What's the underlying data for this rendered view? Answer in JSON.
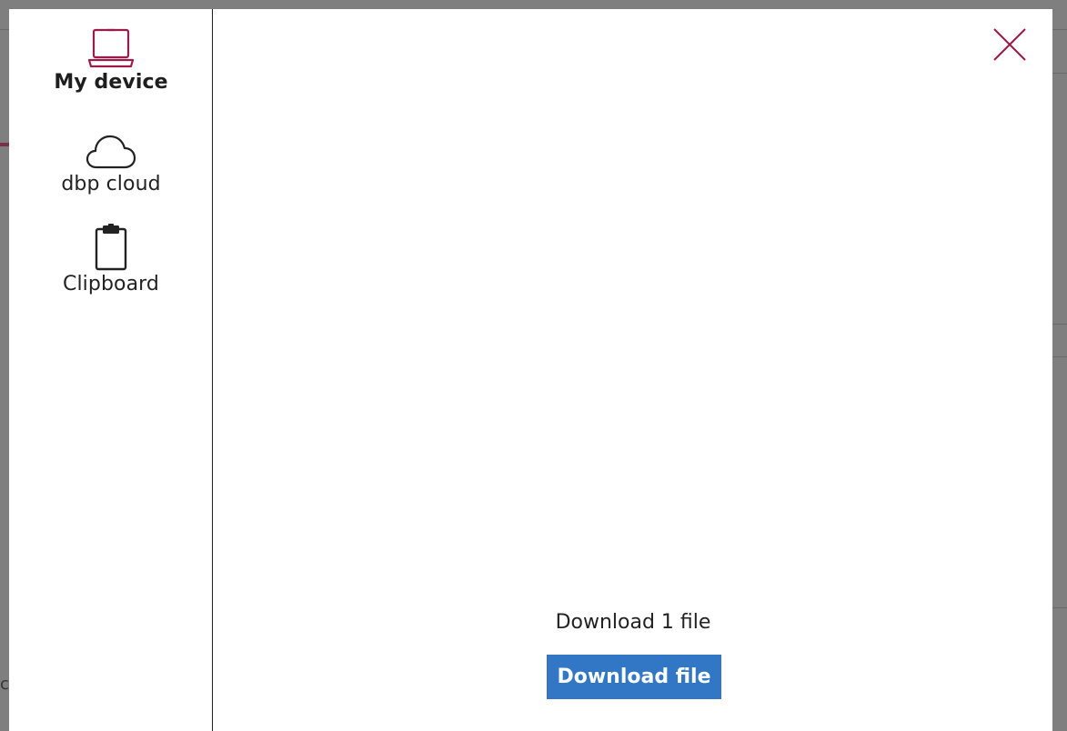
{
  "sidebar": {
    "items": [
      {
        "label": "My device",
        "icon": "laptop-icon",
        "active": true
      },
      {
        "label": "dbp cloud",
        "icon": "cloud-icon",
        "active": false
      },
      {
        "label": "Clipboard",
        "icon": "clipboard-icon",
        "active": false
      }
    ]
  },
  "main": {
    "status_text": "Download 1 file",
    "download_button_label": "Download file"
  },
  "background": {
    "partial_letter": "c"
  },
  "colors": {
    "accent": "#9b1b4a",
    "primary_button": "#3177c6",
    "overlay": "#7f7f7f"
  }
}
